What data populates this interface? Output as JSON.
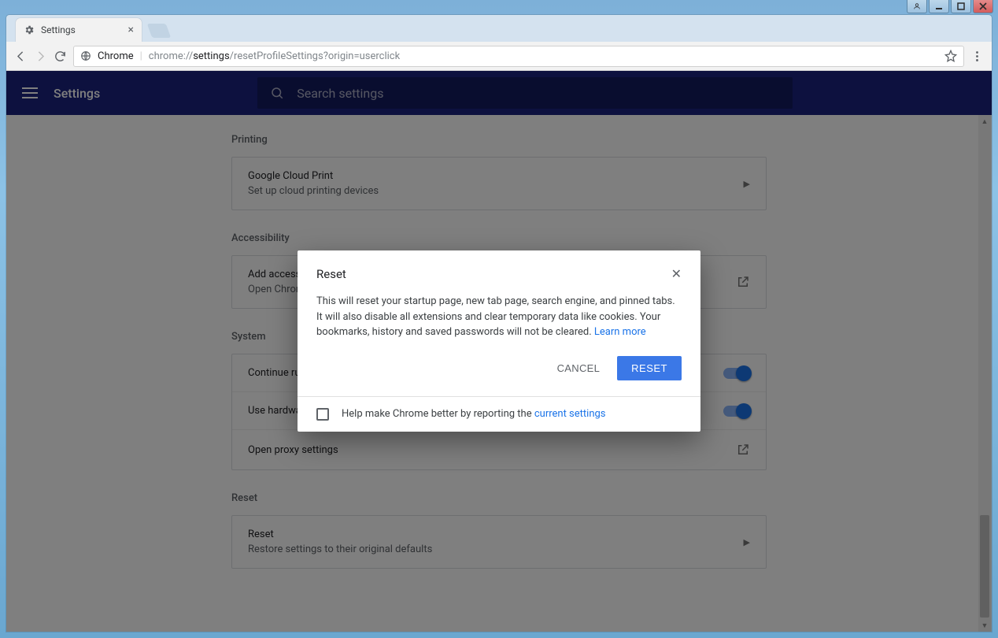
{
  "window": {},
  "browser": {
    "tab_title": "Settings",
    "url_scheme_label": "Chrome",
    "url_grey_1": "chrome://",
    "url_dark": "settings",
    "url_grey_2": "/resetProfileSettings?origin=userclick"
  },
  "header": {
    "title": "Settings",
    "search_placeholder": "Search settings"
  },
  "sections": {
    "printing": {
      "label": "Printing",
      "row": {
        "title": "Google Cloud Print",
        "subtitle": "Set up cloud printing devices"
      }
    },
    "accessibility": {
      "label": "Accessibility",
      "row": {
        "title": "Add accessibility features",
        "subtitle": "Open Chrome Web Store"
      }
    },
    "system": {
      "label": "System",
      "rows": {
        "bg": "Continue running background apps when Google Chrome is closed",
        "hw": "Use hardware acceleration when available",
        "proxy": "Open proxy settings"
      }
    },
    "reset": {
      "label": "Reset",
      "row": {
        "title": "Reset",
        "subtitle": "Restore settings to their original defaults"
      }
    }
  },
  "dialog": {
    "title": "Reset",
    "body_text": "This will reset your startup page, new tab page, search engine, and pinned tabs. It will also disable all extensions and clear temporary data like cookies. Your bookmarks, history and saved passwords will not be cleared. ",
    "learn_more": "Learn more",
    "cancel": "CANCEL",
    "confirm": "RESET",
    "footer_text_pre": "Help make Chrome better by reporting the ",
    "footer_link": "current settings"
  }
}
